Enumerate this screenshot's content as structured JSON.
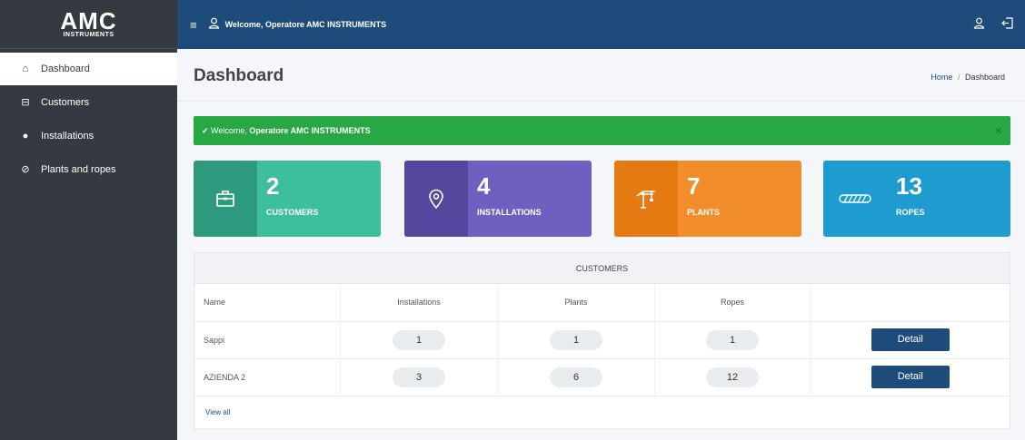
{
  "brand": {
    "main": "AMC",
    "sub": "INSTRUMENTS"
  },
  "sidebar": {
    "items": [
      {
        "label": "Dashboard",
        "icon": "home-icon",
        "glyph": "⌂",
        "active": true
      },
      {
        "label": "Customers",
        "icon": "briefcase-icon",
        "glyph": "⊟",
        "active": false
      },
      {
        "label": "Installations",
        "icon": "map-marker-icon",
        "glyph": "●",
        "active": false
      },
      {
        "label": "Plants and ropes",
        "icon": "compass-icon",
        "glyph": "⊘",
        "active": false
      }
    ]
  },
  "topbar": {
    "welcome": "Welcome, Operatore AMC INSTRUMENTS"
  },
  "header": {
    "title": "Dashboard",
    "breadcrumb": {
      "home": "Home",
      "sep": "/",
      "current": "Dashboard"
    }
  },
  "alert": {
    "prefix": "✔ Welcome,",
    "name": "Operatore AMC INSTRUMENTS",
    "close": "×"
  },
  "stats": [
    {
      "value": "2",
      "label": "CUSTOMERS",
      "icon": "briefcase-icon",
      "color": "#3dbf9c",
      "icon_bg": "#2e9a7d"
    },
    {
      "value": "4",
      "label": "INSTALLATIONS",
      "icon": "map-marker-icon",
      "color": "#6f5fc0",
      "icon_bg": "#56479e"
    },
    {
      "value": "7",
      "label": "PLANTS",
      "icon": "crane-icon",
      "color": "#f28d2b",
      "icon_bg": "#e57a12"
    },
    {
      "value": "13",
      "label": "ROPES",
      "icon": "rope-icon",
      "color": "#1e9ccf",
      "icon_bg": "#1787b5"
    }
  ],
  "customers": {
    "title": "CUSTOMERS",
    "columns": [
      "Name",
      "Installations",
      "Plants",
      "Ropes",
      ""
    ],
    "rows": [
      {
        "name": "Sappi",
        "installations": "1",
        "plants": "1",
        "ropes": "1",
        "action": "Detail"
      },
      {
        "name": "AZIENDA 2",
        "installations": "3",
        "plants": "6",
        "ropes": "12",
        "action": "Detail"
      }
    ],
    "view_all": "View all"
  }
}
